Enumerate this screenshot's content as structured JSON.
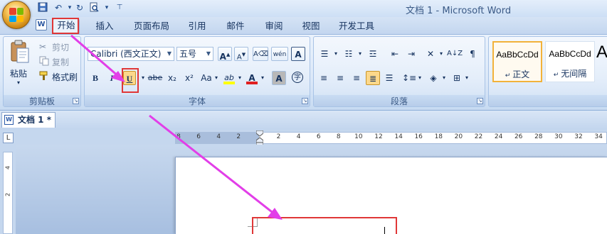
{
  "window": {
    "title": "文档 1 - Microsoft Word",
    "qat": [
      "save-icon",
      "undo-icon",
      "redo-icon",
      "print-preview-icon",
      "customize-qat-icon"
    ]
  },
  "tabs": [
    {
      "label": "开始",
      "active": true
    },
    {
      "label": "插入"
    },
    {
      "label": "页面布局"
    },
    {
      "label": "引用"
    },
    {
      "label": "邮件"
    },
    {
      "label": "审阅"
    },
    {
      "label": "视图"
    },
    {
      "label": "开发工具"
    }
  ],
  "clipboard": {
    "paste": "粘贴",
    "cut": "剪切",
    "copy": "复制",
    "format_painter": "格式刷",
    "group_label": "剪贴板"
  },
  "font": {
    "family": "Calibri (西文正文)",
    "size": "五号",
    "group_label": "字体",
    "grow": "A",
    "shrink": "A",
    "bold": "B",
    "italic": "I",
    "underline": "U",
    "strike": "abe",
    "subscript": "x₂",
    "superscript": "x²",
    "change_case": "Aa",
    "highlight": "ab",
    "font_color": "A",
    "char_shading": "A",
    "enclose": "字",
    "phonetic": "wén",
    "char_border": "A"
  },
  "paragraph": {
    "group_label": "段落"
  },
  "styles": {
    "items": [
      {
        "sample": "AaBbCcDd",
        "name": "正文"
      },
      {
        "sample": "AaBbCcDd",
        "name": "无间隔"
      },
      {
        "sample": "A",
        "name": ""
      }
    ]
  },
  "document": {
    "tab_label": "文档 1 *",
    "tab_selector": "L"
  },
  "ruler": {
    "ticks": [
      "8",
      "6",
      "4",
      "2",
      "2",
      "4",
      "6",
      "8",
      "10",
      "12",
      "14",
      "16",
      "18",
      "20",
      "22",
      "24",
      "26",
      "28",
      "30",
      "32",
      "34"
    ],
    "vticks": [
      "4",
      "2"
    ]
  },
  "colors": {
    "annotation_arrow": "#e23ee8",
    "annotation_box": "#e03737",
    "style_selected": "#f2b23a"
  }
}
